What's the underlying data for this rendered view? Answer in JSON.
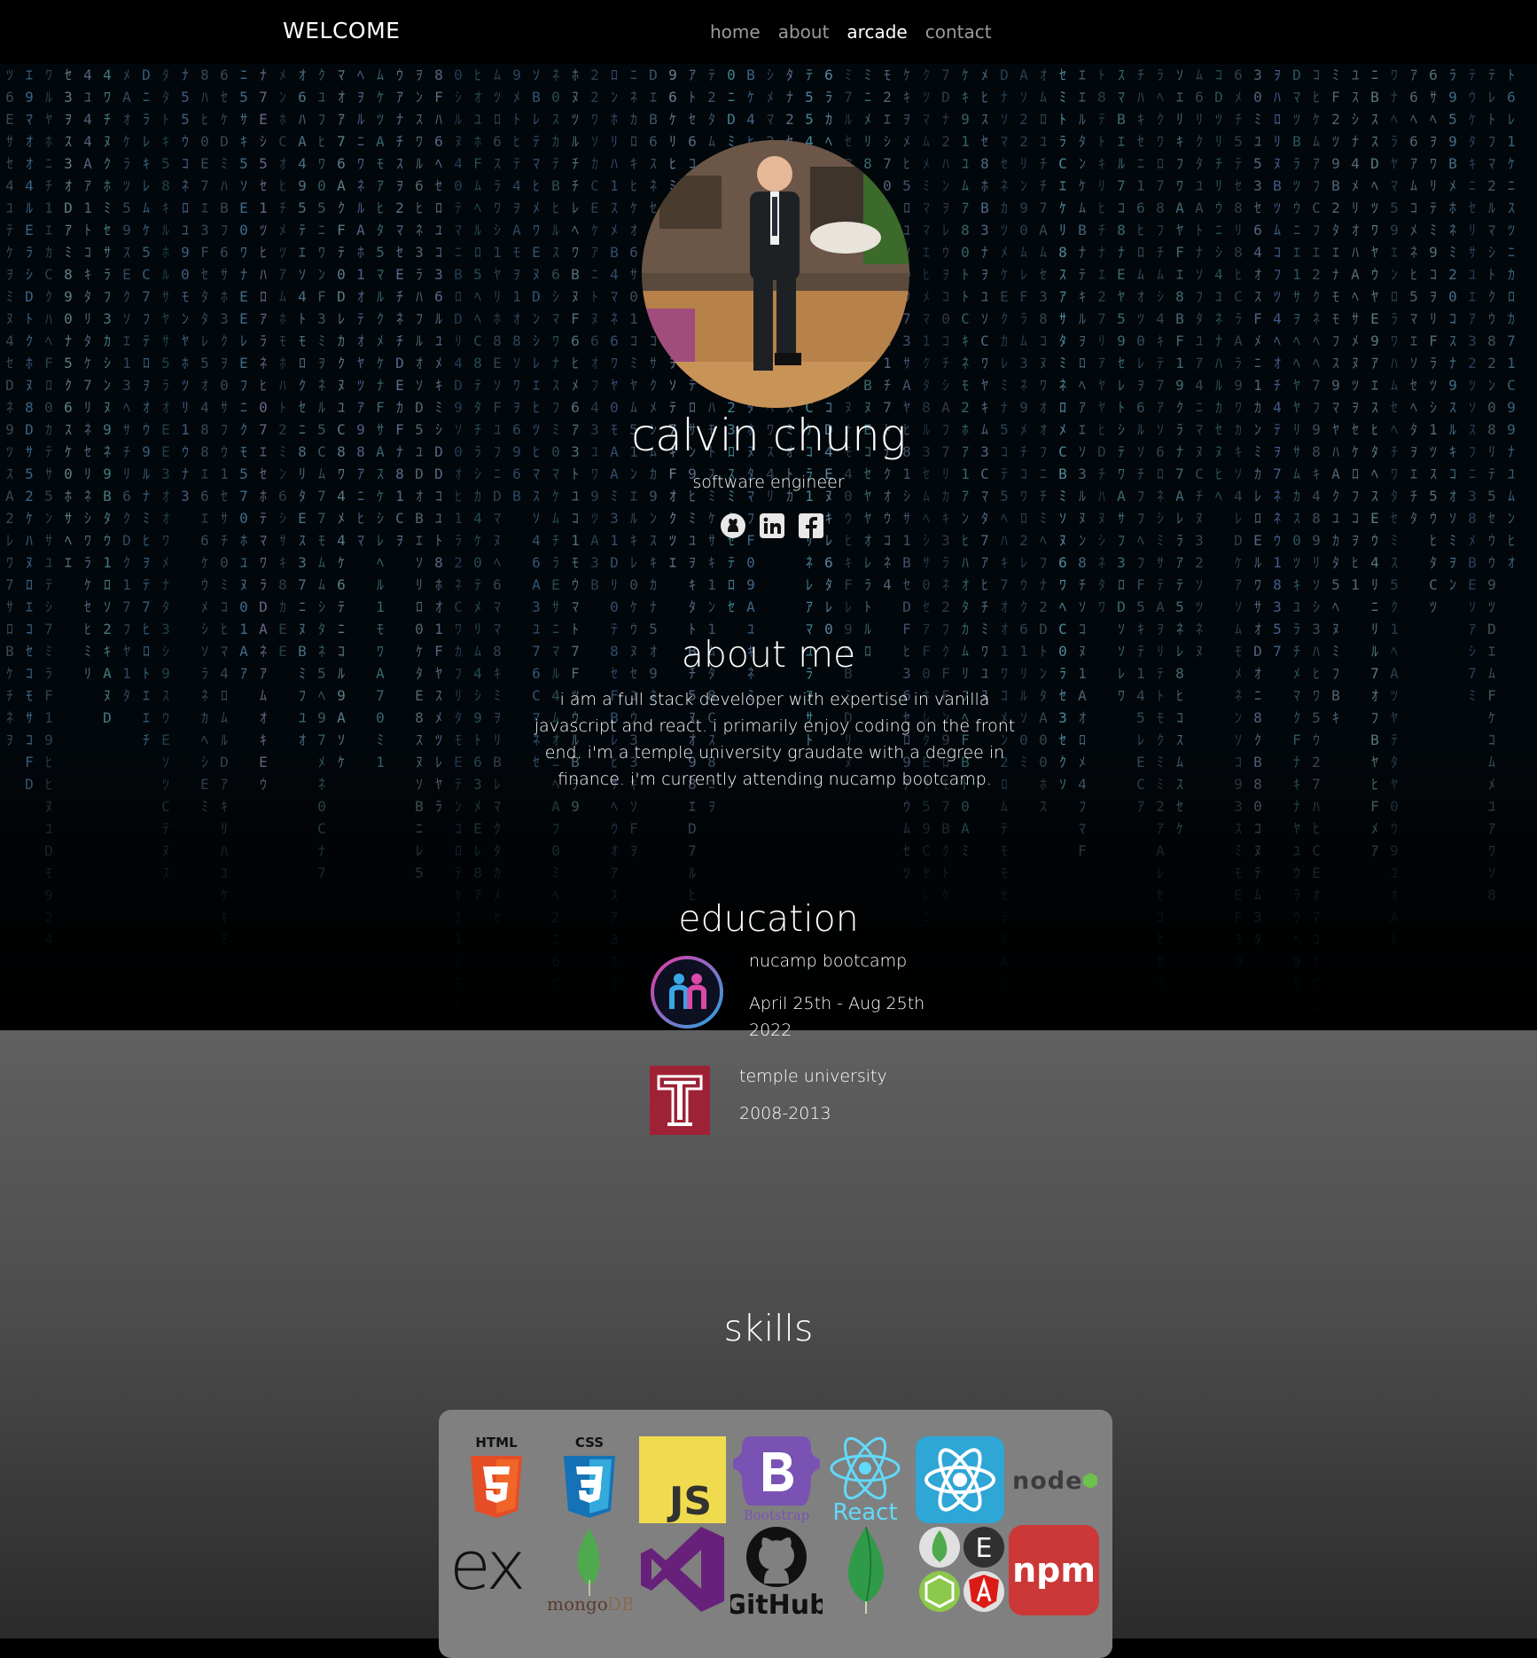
{
  "navbar": {
    "brand": "WELCOME",
    "links": [
      "home",
      "about",
      "arcade",
      "contact"
    ]
  },
  "profile": {
    "name": "calvin chung",
    "role": "software engineer",
    "social_icons": [
      "github-icon",
      "linkedin-icon",
      "facebook-icon"
    ]
  },
  "about": {
    "heading": "about me",
    "text": "i am a full stack developer with expertise in vanilla javascript and react. i primarily enjoy coding on the front end. i'm a temple university graudate with a degree in finance. i'm currently attending nucamp bootcamp."
  },
  "education": {
    "heading": "education",
    "items": [
      {
        "school": "nucamp bootcamp",
        "dates": "April 25th - Aug 25th 2022",
        "logo": "nucamp-logo"
      },
      {
        "school": "temple university",
        "dates": "2008-2013",
        "logo": "temple-logo"
      }
    ]
  },
  "skills": {
    "heading": "skills",
    "logos": [
      "html5",
      "css3",
      "javascript",
      "bootstrap",
      "react",
      "react-native",
      "nodejs",
      "express",
      "mongodb",
      "visual-studio",
      "github",
      "mongodb-leaf",
      "mean-stack",
      "npm"
    ],
    "logo_text": {
      "html": "HTML",
      "css": "CSS",
      "js": "JS",
      "bootstrap": "Bootstrap",
      "react": "React",
      "github": "GitHub",
      "mongo": "mongo",
      "db": "DB",
      "npm": "npm",
      "node": "node",
      "e": "E"
    }
  },
  "colors": {
    "nav_bg": "#000000",
    "gray_top": "#606060",
    "gray_bottom": "#2b2b2b",
    "skills_panel": "#808080",
    "matrix": "#4f87a0"
  }
}
